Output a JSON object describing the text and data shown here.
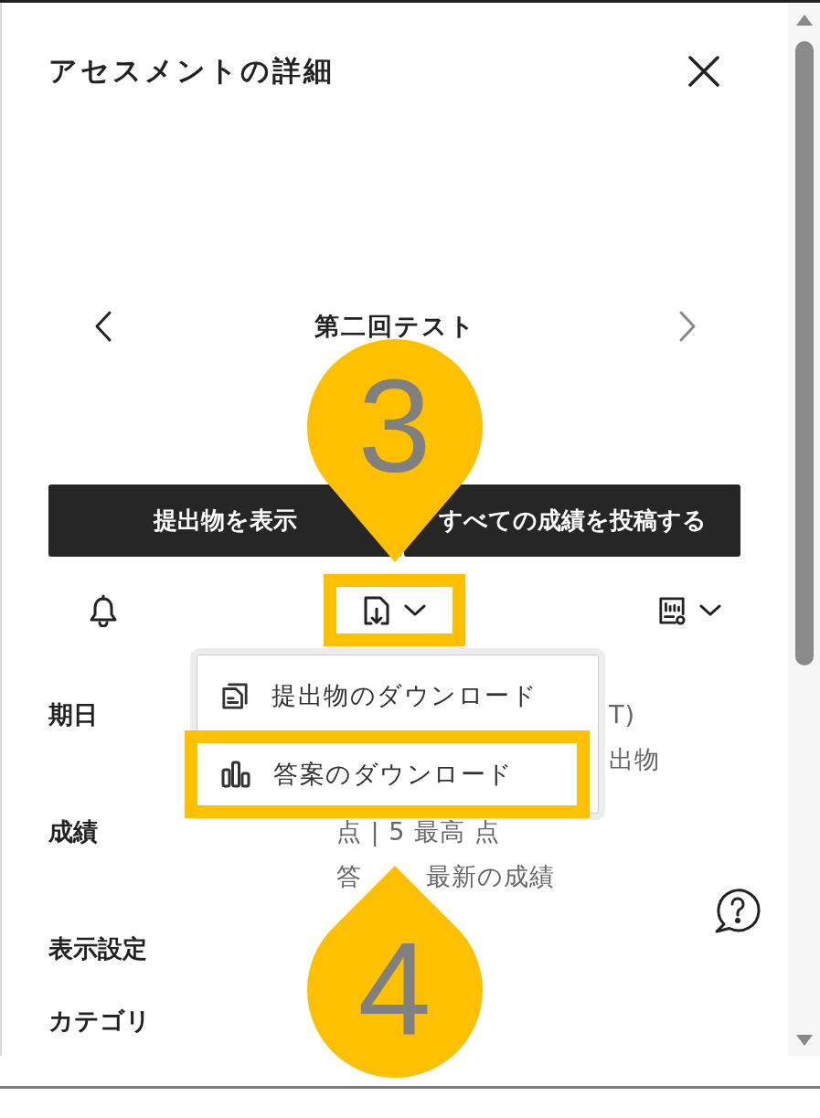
{
  "panel": {
    "title": "アセスメントの詳細"
  },
  "nav": {
    "title": "第二回テスト",
    "previous": {
      "disabled": false
    },
    "next": {
      "disabled": true
    }
  },
  "actions": [
    "提出物を表示",
    "すべての成績を投稿する"
  ],
  "toolbar": [
    {
      "kind": "bell",
      "has_menu": false,
      "highlighted": false
    },
    {
      "kind": "download",
      "has_menu": true,
      "highlighted": true,
      "callout": "3",
      "menu": {
        "open": true,
        "items": [
          {
            "kind": "submissions",
            "label": "提出物のダウンロード",
            "highlighted": false
          },
          {
            "kind": "answers",
            "label": "答案のダウンロード",
            "highlighted": true,
            "callout": "4"
          }
        ]
      }
    },
    {
      "kind": "report",
      "has_menu": true,
      "highlighted": false
    }
  ],
  "details": [
    {
      "label": "期日",
      "lines": [
        [
          "T)"
        ],
        [
          "出物"
        ]
      ]
    },
    {
      "label": "成績",
      "lines": [
        [
          "点 | 5 最高 点"
        ],
        [
          "答",
          "最新の成績"
        ]
      ]
    },
    {
      "label": "表示設定"
    },
    {
      "label": "カテゴリ"
    }
  ]
}
